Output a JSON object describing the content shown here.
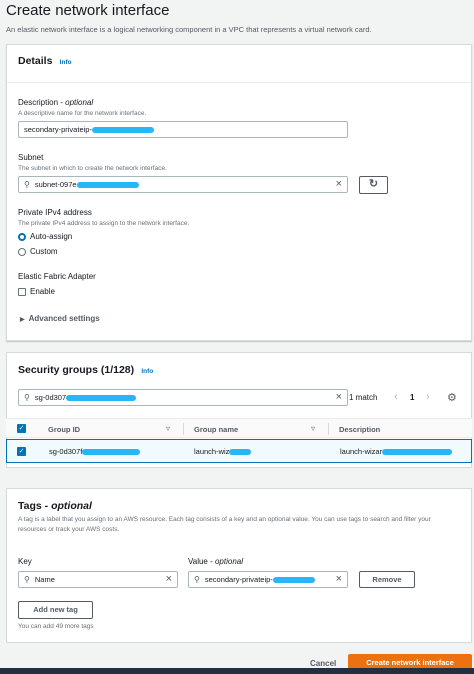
{
  "page": {
    "title": "Create network interface",
    "description": "An elastic network interface is a logical networking component in a VPC that represents a virtual network card."
  },
  "details": {
    "title": "Details",
    "info": "Info",
    "description_label": "Description",
    "optional": "optional",
    "description_hint": "A descriptive name for the network interface.",
    "description_value": "secondary-privateip-",
    "subnet_label": "Subnet",
    "subnet_hint": "The subnet in which to create the network interface.",
    "subnet_value": "subnet-097e",
    "ipv4_label": "Private IPv4 address",
    "ipv4_hint": "The private IPv4 address to assign to the network interface.",
    "ipv4_options": [
      "Auto-assign",
      "Custom"
    ],
    "ipv4_selected": "Auto-assign",
    "efa_label": "Elastic Fabric Adapter",
    "efa_enable": "Enable",
    "advanced": "Advanced settings"
  },
  "security_groups": {
    "title": "Security groups (1/128)",
    "info": "Info",
    "search_value": "sg-0d307",
    "match_count": "1 match",
    "page": "1",
    "columns": [
      "Group ID",
      "Group name",
      "Description"
    ],
    "rows": [
      {
        "group_id": "sg-0d307f",
        "group_name": "launch-wiz",
        "description": "launch-wizar",
        "selected": true
      }
    ]
  },
  "tags": {
    "title": "Tags",
    "optional": "optional",
    "description": "A tag is a label that you assign to an AWS resource. Each tag consists of a key and an optional value. You can use tags to search and filter your resources or track your AWS costs.",
    "key_label": "Key",
    "value_label": "Value",
    "key_value": "Name",
    "value_value": "secondary-privateip-",
    "remove": "Remove",
    "add_new": "Add new tag",
    "remaining": "You can add 49 more tags"
  },
  "footer": {
    "cancel": "Cancel",
    "submit": "Create network interface"
  },
  "colors": {
    "accent": "#0073bb",
    "primary_button": "#ec7211",
    "redaction": "#29b6f6"
  }
}
